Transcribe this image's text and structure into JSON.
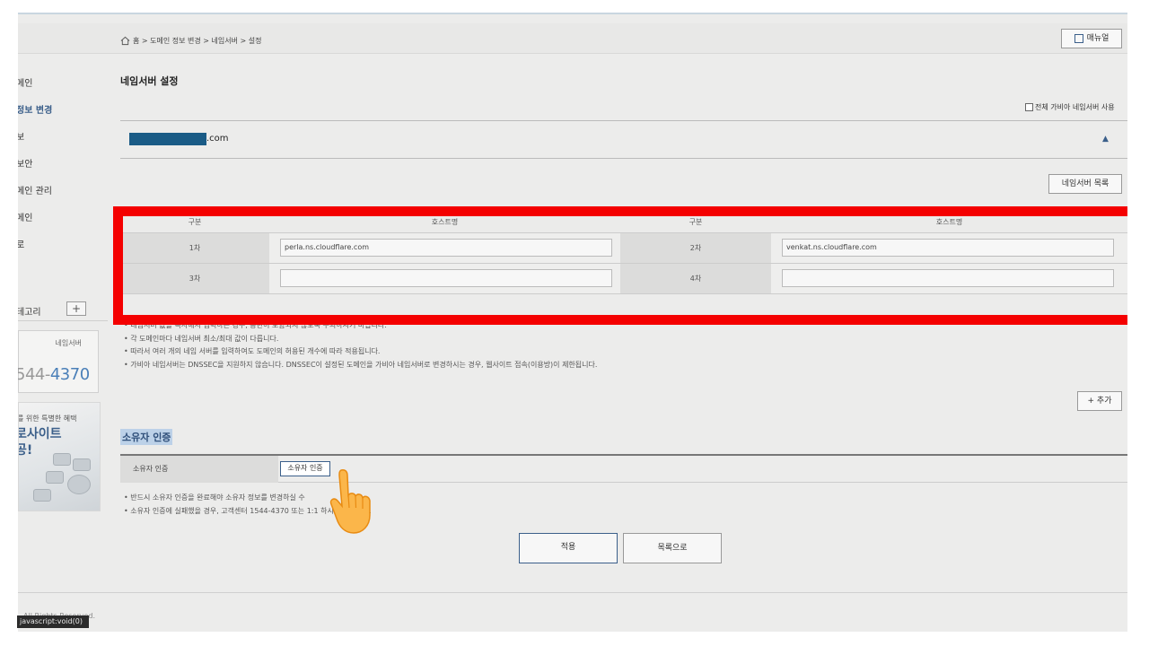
{
  "sidebar": {
    "items": [
      {
        "label": "메인",
        "active": false
      },
      {
        "label": "정보 변경",
        "active": true
      },
      {
        "label": "보",
        "active": false
      },
      {
        "label": "보안",
        "active": false
      },
      {
        "label": "메인 관리",
        "active": false
      },
      {
        "label": "메인",
        "active": false
      },
      {
        "label": "로",
        "active": false
      }
    ],
    "category_label": "테고리",
    "category_add": "+",
    "cs_label": "네임서버",
    "cs_phone_prefix": "544-",
    "cs_phone_hl": "4370",
    "banner_line1": "를 위한 특별한 혜택",
    "banner_line2a": "로사이트",
    "banner_line2b": "공!"
  },
  "header": {
    "breadcrumb": "홈 > 도메인 정보 변경 > 네임서버 > 설정",
    "manual_label": "매뉴얼"
  },
  "page": {
    "title": "네임서버 설정",
    "all_ns_label": "전체 가비아 네임서버 사용",
    "domain_suffix": ".com",
    "collapse_icon": "▲",
    "ns_list_button": "네임서버 목록"
  },
  "ns_table": {
    "col_type": "구분",
    "col_host": "호스트명",
    "rows": [
      {
        "left_label": "1차",
        "left_value": "perla.ns.cloudflare.com",
        "right_label": "2차",
        "right_value": "venkat.ns.cloudflare.com"
      },
      {
        "left_label": "3차",
        "left_value": "",
        "right_label": "4차",
        "right_value": ""
      }
    ]
  },
  "notes": [
    "네임서버 값을 복사해서 입력하는 경우, 공란이 포함되지 않도록 주의하시기 바랍니다.",
    "각 도메인마다 네임서버 최소/최대 값이 다릅니다.",
    "따라서 여러 개의 네임 서버를 입력하여도 도메인의 허용된 개수에 따라 적용됩니다.",
    "가비아 네임서버는 DNSSEC을 지원하지 않습니다. DNSSEC이 설정된 도메인을 가비아 네임서버로 변경하시는 경우, 웹사이트 접속(이용방)이 제한됩니다."
  ],
  "add_button": "+ 추가",
  "owner": {
    "title": "소유자 인증",
    "row_label": "소유자 인증",
    "button": "소유자 인증",
    "notes": [
      "반드시 소유자 인증을 완료해야 소유자 정보를 변경하실 수",
      "소유자 인증에 실패했을 경우, 고객센터 1544-4370 또는 1:1            하시기 바랍니다."
    ]
  },
  "actions": {
    "apply": "적용",
    "to_list": "목록으로"
  },
  "footer": {
    "text": "All Rights Reserved."
  },
  "status_bar": {
    "text": "javascript:void(0)"
  },
  "colors": {
    "highlight_box": "#f40000",
    "accent": "#3b5f8a",
    "domain_redaction": "#1a5b86"
  }
}
